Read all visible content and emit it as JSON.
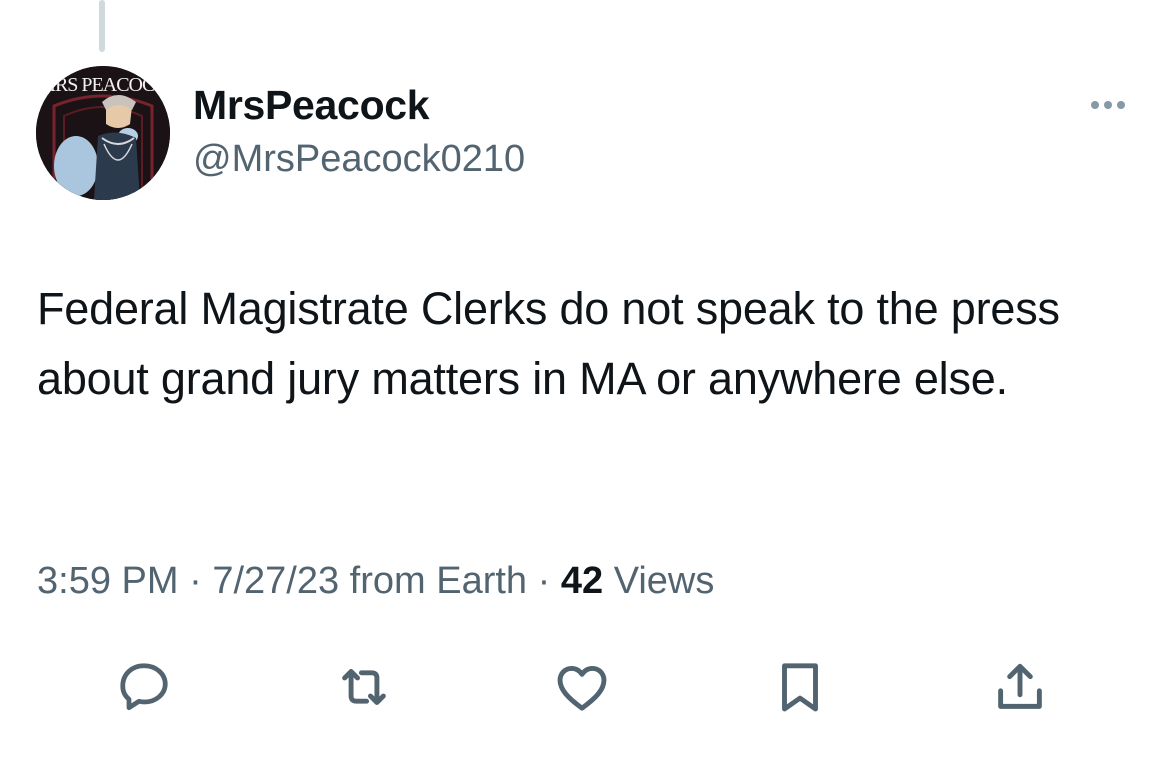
{
  "tweet": {
    "display_name": "MrsPeacock",
    "handle": "@MrsPeacock0210",
    "avatar_label": "MRS PEACOCK",
    "text": "Federal Magistrate Clerks do not speak to the press about grand jury matters in MA or anywhere else.",
    "time": "3:59 PM",
    "date": "7/27/23",
    "source": "from Earth",
    "separator": "·",
    "views_count": "42",
    "views_label": "Views"
  },
  "actions": [
    "reply",
    "retweet",
    "like",
    "bookmark",
    "share"
  ],
  "colors": {
    "text_primary": "#0f1419",
    "text_secondary": "#536471",
    "icon": "#536471",
    "thread_line": "#cfd9de"
  }
}
